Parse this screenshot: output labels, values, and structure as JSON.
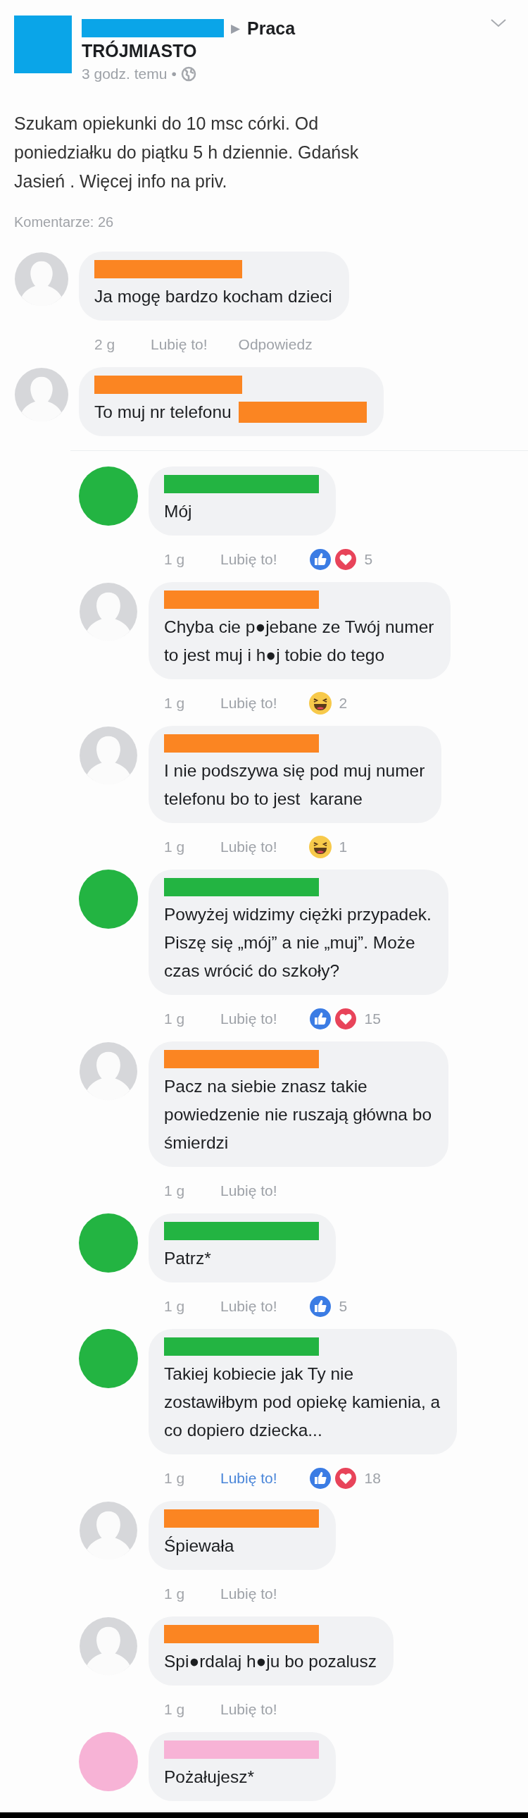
{
  "post": {
    "color": "#0aa5e8",
    "group": "Praca",
    "group_arrow": "▶",
    "location": "TRÓJMIASTO",
    "time": "3 godz. temu",
    "dot": "•",
    "text": "Szukam opiekunki do 10 msc córki. Od\nponiedziałku do piątku 5 h dziennie. Gdańsk\nJasień . Więcej info na priv.",
    "comments_count": "Komentarze: 26"
  },
  "comments": [
    {
      "kind": "silhouette",
      "color": "#fb8522",
      "text": "Ja mogę bardzo kocham dzieci",
      "time": "2 g",
      "like_label": "Lubię to!",
      "liked": false,
      "reply_label": "Odpowiedz"
    },
    {
      "kind": "silhouette",
      "color": "#fb8522",
      "text": "To muj nr telefonu",
      "number_hidden": true
    }
  ],
  "replies": [
    {
      "kind": "dot",
      "color": "#23b442",
      "text": "Mój",
      "time": "1 g",
      "like_label": "Lubię to!",
      "liked": false,
      "reactions": [
        {
          "kind": "like"
        },
        {
          "kind": "love"
        }
      ],
      "reaction_count": "5"
    },
    {
      "kind": "silhouette",
      "color": "#fb8522",
      "text": "Chyba cie p●jebane ze Twój numer\nto jest muj i h●j tobie do tego",
      "time": "1 g",
      "like_label": "Lubię to!",
      "liked": false,
      "reactions": [
        {
          "kind": "haha"
        }
      ],
      "reaction_count": "2"
    },
    {
      "kind": "silhouette",
      "color": "#fb8522",
      "text": "I nie podszywa się pod muj numer\ntelefonu bo to jest  karane",
      "time": "1 g",
      "like_label": "Lubię to!",
      "liked": false,
      "reactions": [
        {
          "kind": "haha"
        }
      ],
      "reaction_count": "1"
    },
    {
      "kind": "dot",
      "color": "#23b442",
      "text": "Powyżej widzimy ciężki przypadek.\nPiszę się „mój” a nie „muj”. Może\nczas wrócić do szkoły?",
      "time": "1 g",
      "like_label": "Lubię to!",
      "liked": false,
      "reactions": [
        {
          "kind": "like"
        },
        {
          "kind": "love"
        }
      ],
      "reaction_count": "15"
    },
    {
      "kind": "silhouette",
      "color": "#fb8522",
      "text": "Pacz na siebie znasz takie\npowiedzenie nie ruszają główna bo\nśmierdzi",
      "time": "1 g",
      "like_label": "Lubię to!",
      "liked": false
    },
    {
      "kind": "dot",
      "color": "#23b442",
      "text": "Patrz*",
      "time": "1 g",
      "like_label": "Lubię to!",
      "liked": false,
      "reactions": [
        {
          "kind": "like"
        }
      ],
      "reaction_count": "5"
    },
    {
      "kind": "dot",
      "color": "#23b442",
      "text": "Takiej kobiecie jak Ty nie\nzostawiłbym pod opiekę kamienia, a\nco dopiero dziecka...",
      "time": "1 g",
      "like_label": "Lubię to!",
      "liked": true,
      "reactions": [
        {
          "kind": "like"
        },
        {
          "kind": "love"
        }
      ],
      "reaction_count": "18"
    },
    {
      "kind": "silhouette",
      "color": "#fb8522",
      "text": "Śpiewała",
      "time": "1 g",
      "like_label": "Lubię to!",
      "liked": false
    },
    {
      "kind": "silhouette",
      "color": "#fb8522",
      "text": "Spi●rdalaj h●ju bo pozalusz",
      "time": "1 g",
      "like_label": "Lubię to!",
      "liked": false
    },
    {
      "kind": "dot",
      "color": "#f7b3d6",
      "text": "Pożałujesz*"
    }
  ]
}
